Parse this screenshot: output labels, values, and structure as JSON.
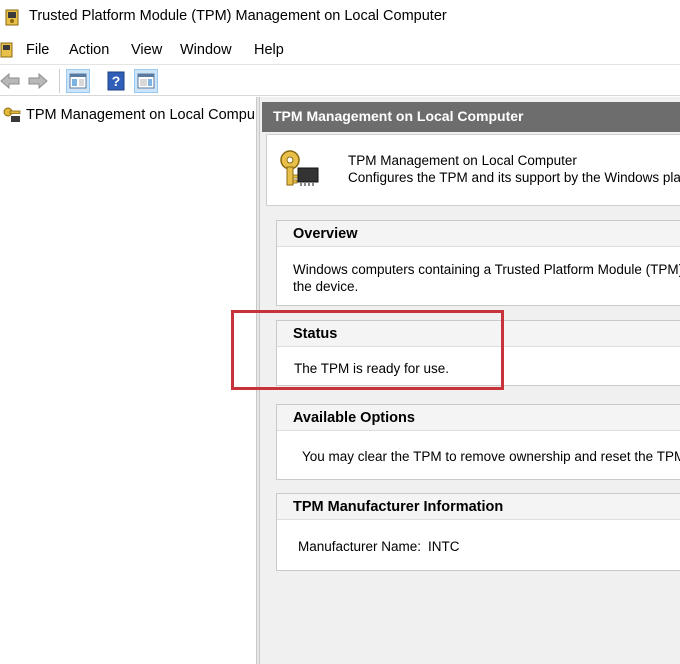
{
  "window": {
    "title": "Trusted Platform Module (TPM) Management on Local Computer",
    "icon": "tpm-snapin-icon"
  },
  "menu": {
    "items": [
      {
        "label": "File"
      },
      {
        "label": "Action"
      },
      {
        "label": "View"
      },
      {
        "label": "Window"
      },
      {
        "label": "Help"
      }
    ]
  },
  "toolbar": {
    "buttons": [
      "back-arrow-icon",
      "forward-arrow-icon",
      "show-hide-tree-icon",
      "help-icon",
      "show-hide-action-pane-icon"
    ]
  },
  "tree": {
    "root": {
      "label": "TPM Management on Local Compu",
      "icon": "tpm-key-icon"
    }
  },
  "content": {
    "header": "TPM Management on Local Computer",
    "info": {
      "title": "TPM Management on Local Computer",
      "description": "Configures the TPM and its support by the Windows platf"
    },
    "sections": {
      "overview": {
        "title": "Overview",
        "line1": "Windows computers containing a Trusted Platform Module (TPM)",
        "line2": "the device."
      },
      "status": {
        "title": "Status",
        "text": "The TPM is ready for use."
      },
      "options": {
        "title": "Available Options",
        "text": "You may clear the TPM to remove ownership and reset the TPM"
      },
      "manufacturer": {
        "title": "TPM Manufacturer Information",
        "label": "Manufacturer Name:",
        "value": "INTC"
      }
    }
  },
  "colors": {
    "header_bg": "#6d6d6d",
    "highlight": "#c8323a",
    "pane_bg": "#f0f0f0"
  }
}
